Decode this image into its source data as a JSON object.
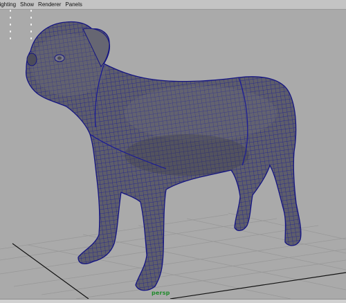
{
  "menubar": {
    "items": [
      "Lighting",
      "Show",
      "Renderer",
      "Panels"
    ]
  },
  "viewport": {
    "camera_label": "persp",
    "background_color": "#aaaaaa",
    "grid_color": "#989898",
    "mesh_fill": "#5e5e6a",
    "wire_color": "#1a1a96",
    "camera_label_color": "#1f8a2a"
  }
}
